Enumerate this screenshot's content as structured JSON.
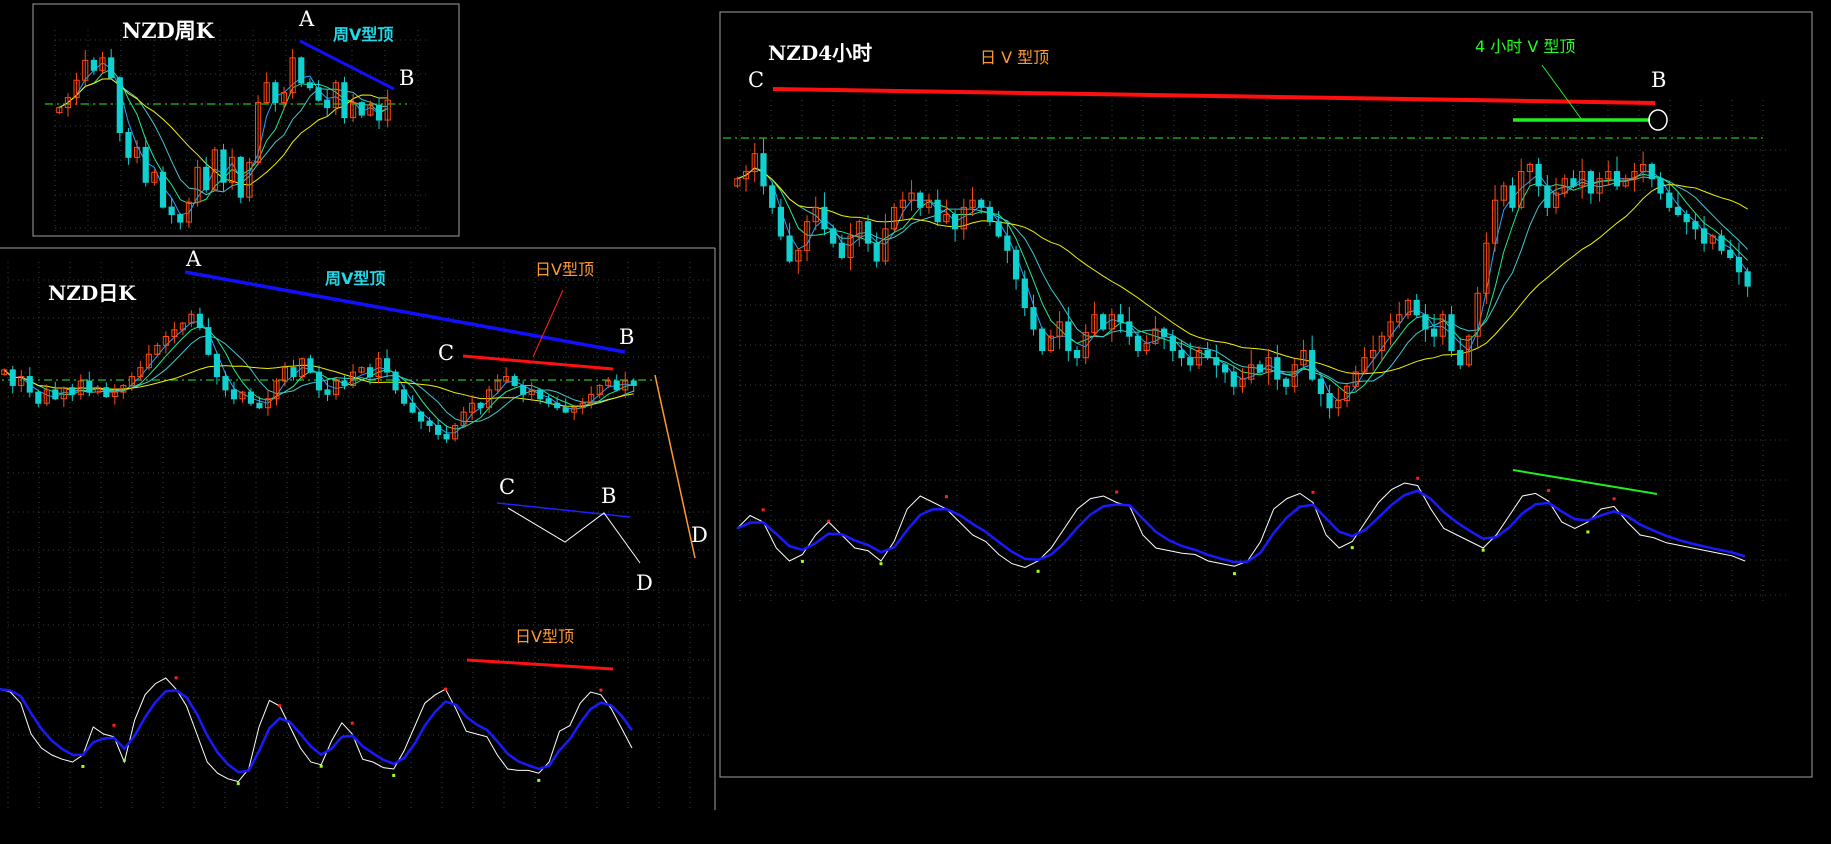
{
  "weekly": {
    "title": "NZD周K",
    "annotation": "周V型顶",
    "point_a": "A",
    "point_b": "B"
  },
  "daily": {
    "title": "NZD日K",
    "weekly_annotation": "周V型顶",
    "daily_annotation": "日V型顶",
    "osc_annotation": "日V型顶",
    "point_a": "A",
    "point_b": "B",
    "point_c": "C",
    "point_d": "D",
    "diagram": {
      "c": "C",
      "b": "B",
      "d": "D"
    }
  },
  "h4": {
    "title": "NZD4小时",
    "daily_annotation": "日 V 型顶",
    "h4_annotation": "4 小时 V 型顶",
    "point_c": "C",
    "point_b": "B"
  },
  "colors": {
    "up_candle": "#ff4a10",
    "down_candle": "#10d0d0",
    "ma": [
      "#2aa0ff",
      "#20e890",
      "#40c8d0",
      "#f0f000"
    ],
    "osc_fast": "#ffffff",
    "osc_slow": "#1a1aff",
    "peak_dot": "#ff2020",
    "trough_dot": "#a0ff20",
    "blue_trend": "#1010ff",
    "red_trend": "#ff1010",
    "green_trend": "#20f020",
    "ref_line": "#20c020"
  },
  "chart_data": [
    {
      "type": "candlestick",
      "title": "NZD周K",
      "ylim": [
        10,
        92
      ],
      "ma_periods": [
        3,
        5,
        8,
        13
      ],
      "close": [
        60,
        64,
        71,
        79,
        75,
        80,
        72,
        50,
        40,
        44,
        30,
        34,
        20,
        17,
        14,
        22,
        36,
        27,
        43,
        30,
        40,
        24,
        38,
        62,
        70,
        62,
        66,
        80,
        70,
        68,
        63,
        60,
        70,
        56,
        62,
        57,
        61,
        55,
        63
      ]
    },
    {
      "type": "candlestick",
      "title": "NZD日K",
      "ylim": [
        20,
        100
      ],
      "ma_periods": [
        3,
        5,
        8,
        20
      ],
      "close": [
        65,
        58,
        62,
        55,
        50,
        56,
        52,
        57,
        54,
        60,
        55,
        57,
        53,
        55,
        58,
        62,
        66,
        72,
        76,
        80,
        83,
        86,
        90,
        84,
        72,
        62,
        56,
        52,
        55,
        50,
        48,
        52,
        60,
        66,
        62,
        70,
        64,
        56,
        54,
        60,
        58,
        64,
        66,
        62,
        70,
        64,
        56,
        50,
        46,
        42,
        40,
        36,
        34,
        40,
        46,
        50,
        48,
        56,
        60,
        62,
        58,
        54,
        56,
        52,
        50,
        48,
        46,
        48,
        50,
        54,
        58,
        60,
        56,
        60,
        58
      ]
    },
    {
      "type": "candlestick",
      "title": "NZD4小时",
      "ylim": [
        5,
        100
      ],
      "ma_periods": [
        3,
        5,
        8,
        21
      ],
      "close": [
        78,
        80,
        85,
        76,
        70,
        62,
        55,
        58,
        66,
        70,
        64,
        60,
        56,
        62,
        66,
        60,
        55,
        64,
        70,
        72,
        74,
        70,
        72,
        66,
        68,
        64,
        70,
        72,
        70,
        66,
        62,
        58,
        50,
        42,
        36,
        30,
        34,
        38,
        30,
        28,
        35,
        40,
        36,
        40,
        38,
        34,
        30,
        32,
        36,
        34,
        30,
        28,
        26,
        30,
        28,
        26,
        24,
        20,
        22,
        26,
        24,
        28,
        22,
        20,
        26,
        30,
        22,
        18,
        14,
        16,
        20,
        24,
        28,
        30,
        34,
        38,
        40,
        44,
        40,
        36,
        34,
        40,
        30,
        26,
        34,
        46,
        60,
        72,
        76,
        70,
        80,
        82,
        76,
        70,
        74,
        78,
        76,
        80,
        74,
        78,
        80,
        76,
        78,
        80,
        82,
        78,
        74,
        70,
        68,
        66,
        64,
        60,
        62,
        58,
        56,
        52,
        48
      ],
      "oscillator_fast": [
        55,
        65,
        60,
        40,
        30,
        35,
        50,
        60,
        50,
        40,
        38,
        30,
        45,
        70,
        80,
        75,
        70,
        60,
        50,
        45,
        35,
        28,
        25,
        30,
        40,
        55,
        70,
        78,
        80,
        75,
        72,
        50,
        40,
        38,
        36,
        35,
        30,
        28,
        26,
        30,
        45,
        70,
        78,
        82,
        75,
        50,
        40,
        45,
        60,
        75,
        85,
        90,
        88,
        70,
        55,
        50,
        45,
        40,
        50,
        65,
        80,
        82,
        76,
        60,
        55,
        60,
        70,
        72,
        60,
        50,
        48,
        44,
        42,
        40,
        38,
        36,
        34,
        30
      ]
    }
  ],
  "daily_oscillator": {
    "fast": [
      72,
      70,
      62,
      40,
      30,
      25,
      22,
      20,
      25,
      45,
      40,
      38,
      20,
      50,
      68,
      76,
      80,
      72,
      60,
      40,
      20,
      12,
      8,
      6,
      15,
      45,
      64,
      60,
      45,
      30,
      20,
      18,
      35,
      48,
      40,
      22,
      20,
      16,
      15,
      28,
      45,
      62,
      68,
      72,
      58,
      42,
      40,
      38,
      25,
      15,
      14,
      14,
      12,
      20,
      42,
      46,
      62,
      70,
      68,
      58,
      44,
      30
    ]
  }
}
